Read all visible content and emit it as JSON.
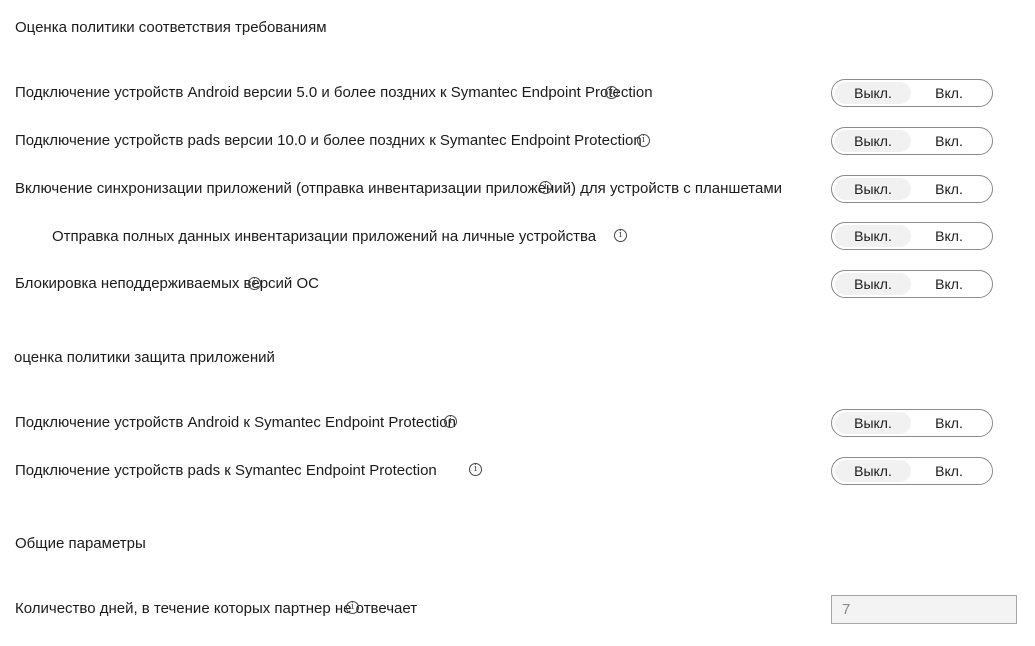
{
  "sections": {
    "compliance": {
      "title": "Оценка политики соответствия требованиям",
      "rows": [
        {
          "label": "Подключение устройств Android версии 5.0 и более поздних к Symantec Endpoint Protection",
          "off": "Выкл.",
          "on": "Вкл."
        },
        {
          "label": "Подключение устройств pads версии 10.0 и более поздних к Symantec Endpoint Protection",
          "off": "Выкл.",
          "on": "Вкл."
        },
        {
          "label": "Включение синхронизации приложений (отправка инвентаризации приложений) для устройств с планшетами",
          "off": "Выкл.",
          "on": "Вкл."
        },
        {
          "label": "Отправка полных данных инвентаризации приложений на личные устройства",
          "off": "Выкл.",
          "on": "Вкл."
        },
        {
          "label": "Блокировка неподдерживаемых версий ОС",
          "off": "Выкл.",
          "on": "Вкл."
        }
      ]
    },
    "app_protection": {
      "title": "оценка политики защита приложений",
      "rows": [
        {
          "label": "Подключение устройств Android к Symantec Endpoint Protection",
          "off": "Выкл.",
          "on": "Вкл."
        },
        {
          "label": "Подключение устройств pads к Symantec Endpoint Protection",
          "off": "Выкл.",
          "on": "Вкл."
        }
      ]
    },
    "general": {
      "title": "Общие параметры",
      "days_label": "Количество дней, в течение которых партнер не отвечает",
      "days_value": "7"
    }
  },
  "icons": {
    "info": "info-icon"
  }
}
